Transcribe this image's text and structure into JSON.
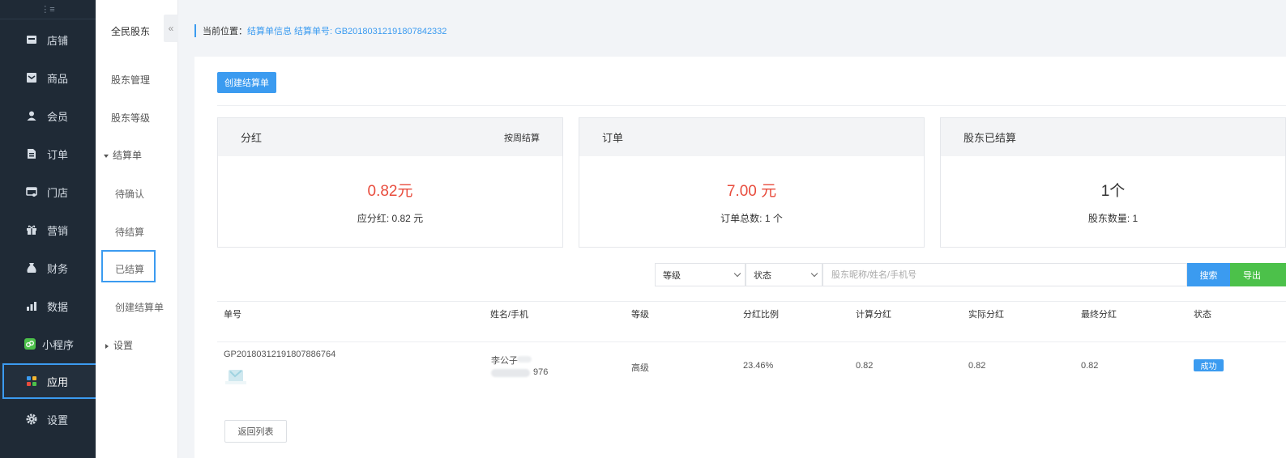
{
  "sidebar": {
    "items": [
      {
        "label": "店铺",
        "icon": "store-icon"
      },
      {
        "label": "商品",
        "icon": "goods-icon"
      },
      {
        "label": "会员",
        "icon": "member-icon"
      },
      {
        "label": "订单",
        "icon": "order-icon"
      },
      {
        "label": "门店",
        "icon": "shop-icon"
      },
      {
        "label": "营销",
        "icon": "gift-icon"
      },
      {
        "label": "财务",
        "icon": "money-bag-icon"
      },
      {
        "label": "数据",
        "icon": "bar-chart-icon"
      },
      {
        "label": "小程序",
        "icon": "mini-program-icon"
      },
      {
        "label": "应用",
        "icon": "apps-grid-icon"
      },
      {
        "label": "设置",
        "icon": "gear-icon"
      }
    ],
    "active": "应用"
  },
  "subnav": {
    "title": "全民股东",
    "items": [
      {
        "label": "股东管理"
      },
      {
        "label": "股东等级"
      },
      {
        "label": "结算单"
      },
      {
        "label": "待确认"
      },
      {
        "label": "待结算"
      },
      {
        "label": "已结算"
      },
      {
        "label": "创建结算单"
      },
      {
        "label": "设置"
      }
    ],
    "active": "已结算"
  },
  "breadcrumb": {
    "label": "当前位置：",
    "path": "结算单信息 结算单号: GB20180312191807842332"
  },
  "toolbar": {
    "create_label": "创建结算单"
  },
  "cards": [
    {
      "title": "分红",
      "right": "按周结算",
      "value": "0.82元",
      "sub": "应分红: 0.82 元"
    },
    {
      "title": "订单",
      "right": "",
      "value": "7.00 元",
      "sub": "订单总数: 1 个"
    },
    {
      "title": "股东已结算",
      "right": "",
      "value": "1个",
      "sub": "股东数量: 1"
    }
  ],
  "filters": {
    "level": "等级",
    "status": "状态",
    "search_placeholder": "股东昵称/姓名/手机号",
    "search_label": "搜索",
    "export_label": "导出"
  },
  "table": {
    "columns": [
      "单号",
      "姓名/手机",
      "等级",
      "分红比例",
      "计算分红",
      "实际分红",
      "最终分红",
      "状态"
    ],
    "rows": [
      {
        "order_no": "GP20180312191807886764",
        "name": "李公子",
        "phone": "976",
        "level": "高级",
        "ratio": "23.46%",
        "calc": "0.82",
        "actual": "0.82",
        "final": "0.82",
        "status": "成功"
      }
    ]
  },
  "footer": {
    "back_label": "返回列表"
  },
  "colors": {
    "accent": "#3b9bf0",
    "export": "#4cc14a",
    "value_red": "#e84c3d",
    "sidebar_bg": "#1f2a36"
  }
}
